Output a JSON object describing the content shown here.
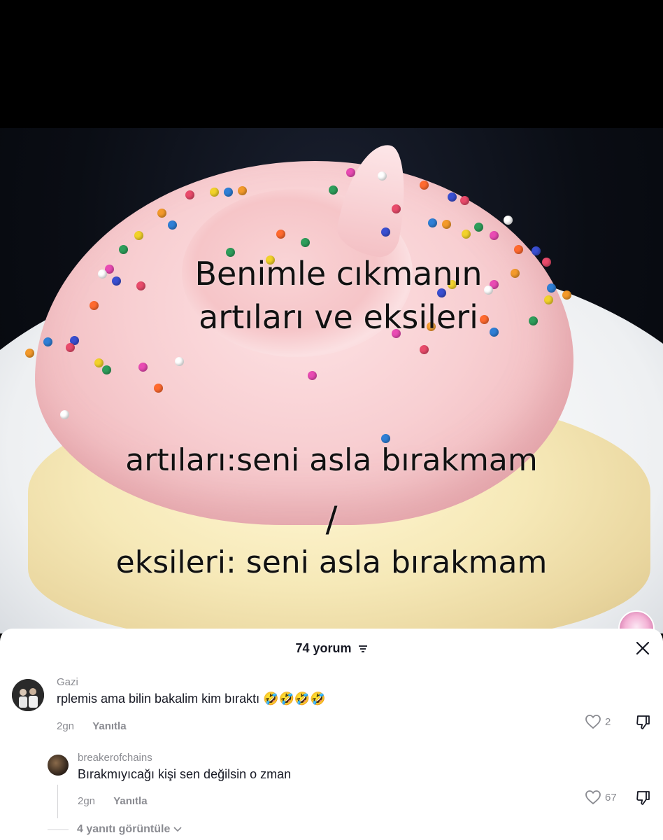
{
  "video": {
    "overlay": {
      "title_line1": "Benimle cıkmanın",
      "title_line2": "artıları ve eksileri",
      "pros": "artıları:seni asla bırakmam",
      "slash": "/",
      "cons": "eksileri: seni asla bırakmam"
    }
  },
  "comments_sheet": {
    "title": "74 yorum",
    "sort_icon": "sort-icon",
    "close_icon": "close-icon",
    "comments": [
      {
        "username": "Gazi",
        "text": "rplemis ama bilin bakalim kim bıraktı 🤣🤣🤣🤣",
        "time": "2gn",
        "reply_label": "Yanıtla",
        "likes": "2"
      },
      {
        "username": "breakerofchains",
        "text": "Bırakmıyıcağı kişi sen değilsin o zman",
        "time": "2gn",
        "reply_label": "Yanıtla",
        "likes": "67"
      }
    ],
    "view_replies": "4 yanıtı görüntüle"
  },
  "colors": {
    "text_primary": "#161823",
    "text_secondary": "#8a8b91",
    "frosting": "#f8cfd2"
  }
}
